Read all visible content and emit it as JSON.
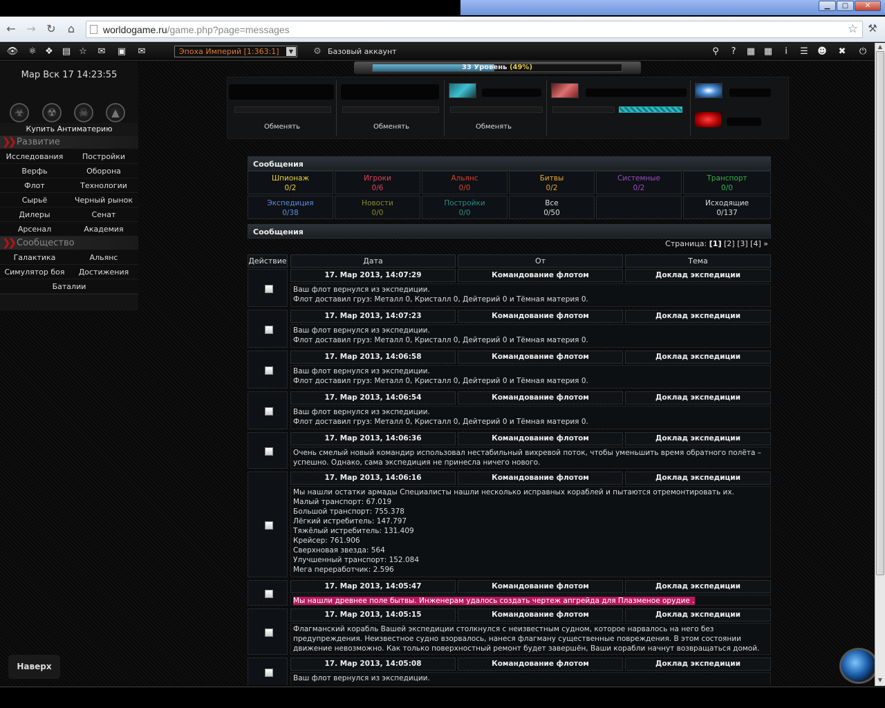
{
  "window": {
    "min_label": "▁",
    "max_label": "▢",
    "close_label": "✕"
  },
  "browser": {
    "url_host": "worldogame.ru",
    "url_path": "/game.php?page=messages"
  },
  "gamebar": {
    "universe": "Эпоха Империй [1:363:1]",
    "account": "Базовый аккаунт"
  },
  "sidebar": {
    "clock": "Мар Вск 17 14:23:55",
    "buy_antimatter": "Купить Антиматерию",
    "section_development": "Развитие",
    "development_items": [
      "Исследования",
      "Постройки",
      "Верфь",
      "Оборона",
      "Флот",
      "Технологии",
      "Сырьё",
      "Черный рынок",
      "Дилеры",
      "Сенат",
      "Арсенал",
      "Академия"
    ],
    "section_community": "Сообщество",
    "community_items": [
      "Галактика",
      "Альянс",
      "Симулятор боя",
      "Достижения",
      "Баталии"
    ]
  },
  "level": {
    "label": "33 Уровень",
    "percent_label": "(49%)",
    "fraction": 0.49
  },
  "banner": {
    "change_labels": [
      "Обменять",
      "Обменять",
      "Обменять"
    ]
  },
  "messages_panel": {
    "title": "Сообщения",
    "categories": [
      {
        "name": "Шпионаж",
        "count": "0/2",
        "color": "#e8d23a"
      },
      {
        "name": "Игроки",
        "count": "0/6",
        "color": "#e0435c"
      },
      {
        "name": "Альянс",
        "count": "0/0",
        "color": "#d8402a"
      },
      {
        "name": "Битвы",
        "count": "0/2",
        "color": "#e8a92a"
      },
      {
        "name": "Системные",
        "count": "0/2",
        "color": "#9a4bc2"
      },
      {
        "name": "Транспорт",
        "count": "0/0",
        "color": "#2fb34a"
      },
      {
        "name": "Экспедиция",
        "count": "0/38",
        "color": "#5b8fe0"
      },
      {
        "name": "Новости",
        "count": "0/0",
        "color": "#8a8a2a"
      },
      {
        "name": "Постройки",
        "count": "0/0",
        "color": "#2e8b8b"
      },
      {
        "name": "Все",
        "count": "0/50",
        "color": "#dddddd"
      },
      {
        "name": "",
        "count": "",
        "color": "#dddddd"
      },
      {
        "name": "Исходящие",
        "count": "0/137",
        "color": "#dddddd"
      }
    ]
  },
  "list": {
    "title": "Сообщения",
    "pager_label": "Страница:",
    "pages": [
      "[1]",
      "[2]",
      "[3]",
      "[4]",
      "»"
    ],
    "columns": {
      "action": "Действие",
      "date": "Дата",
      "from": "От",
      "subject": "Тема"
    },
    "messages": [
      {
        "date": "17. Мар 2013, 14:07:29",
        "from": "Командование флотом",
        "subject": "Доклад экспедиции",
        "lines": [
          "Ваш флот вернулся из экспедиции.",
          "Флот доставил груз: Металл 0, Кристалл 0, Дейтерий 0 и Тёмная материя 0."
        ]
      },
      {
        "date": "17. Мар 2013, 14:07:23",
        "from": "Командование флотом",
        "subject": "Доклад экспедиции",
        "lines": [
          "Ваш флот вернулся из экспедиции.",
          "Флот доставил груз: Металл 0, Кристалл 0, Дейтерий 0 и Тёмная материя 0."
        ]
      },
      {
        "date": "17. Мар 2013, 14:06:58",
        "from": "Командование флотом",
        "subject": "Доклад экспедиции",
        "lines": [
          "Ваш флот вернулся из экспедиции.",
          "Флот доставил груз: Металл 0, Кристалл 0, Дейтерий 0 и Тёмная материя 0."
        ]
      },
      {
        "date": "17. Мар 2013, 14:06:54",
        "from": "Командование флотом",
        "subject": "Доклад экспедиции",
        "lines": [
          "Ваш флот вернулся из экспедиции.",
          "Флот доставил груз: Металл 0, Кристалл 0, Дейтерий 0 и Тёмная материя 0."
        ]
      },
      {
        "date": "17. Мар 2013, 14:06:36",
        "from": "Командование флотом",
        "subject": "Доклад экспедиции",
        "lines": [
          "Очень смелый новый командир использовал нестабильный вихревой поток, чтобы уменьшить время обратного полёта – успешно. Однако, сама экспедиция не принесла ничего нового."
        ]
      },
      {
        "date": "17. Мар 2013, 14:06:16",
        "from": "Командование флотом",
        "subject": "Доклад экспедиции",
        "lines": [
          "Мы нашли остатки армады Специалисты нашли несколько исправных кораблей и пытаются отремонтировать их.",
          "Малый транспорт: 67.019",
          "Большой транспорт: 755.378",
          "Лёгкий истребитель: 147.797",
          "Тяжёлый истребитель: 131.409",
          "Крейсер: 761.906",
          "Сверхновая звезда: 564",
          "Улучшенный транспорт: 152.084",
          "Мега переработчик: 2.596"
        ]
      },
      {
        "date": "17. Мар 2013, 14:05:47",
        "from": "Командование флотом",
        "subject": "Доклад экспедиции",
        "highlight": "Мы нашли древнее поле бытвы. Инженерам удалось создать чертеж апгрейда для Плазменое орудие ."
      },
      {
        "date": "17. Мар 2013, 14:05:15",
        "from": "Командование флотом",
        "subject": "Доклад экспедиции",
        "lines": [
          "Флагманский корабль Вашей экспедиции столкнулся с неизвестным судном, которое нарвалось на него без предупреждения. Неизвестное судно взорвалось, нанеся флагману существенные повреждения. В этом состоянии движение невозможно. Как только поверхностный ремонт будет завершён, Ваши корабли начнут возвращаться домой."
        ]
      },
      {
        "date": "17. Мар 2013, 14:05:08",
        "from": "Командование флотом",
        "subject": "Доклад экспедиции",
        "lines": [
          "Ваш флот вернулся из экспедиции."
        ]
      }
    ]
  },
  "to_top": "Наверх"
}
